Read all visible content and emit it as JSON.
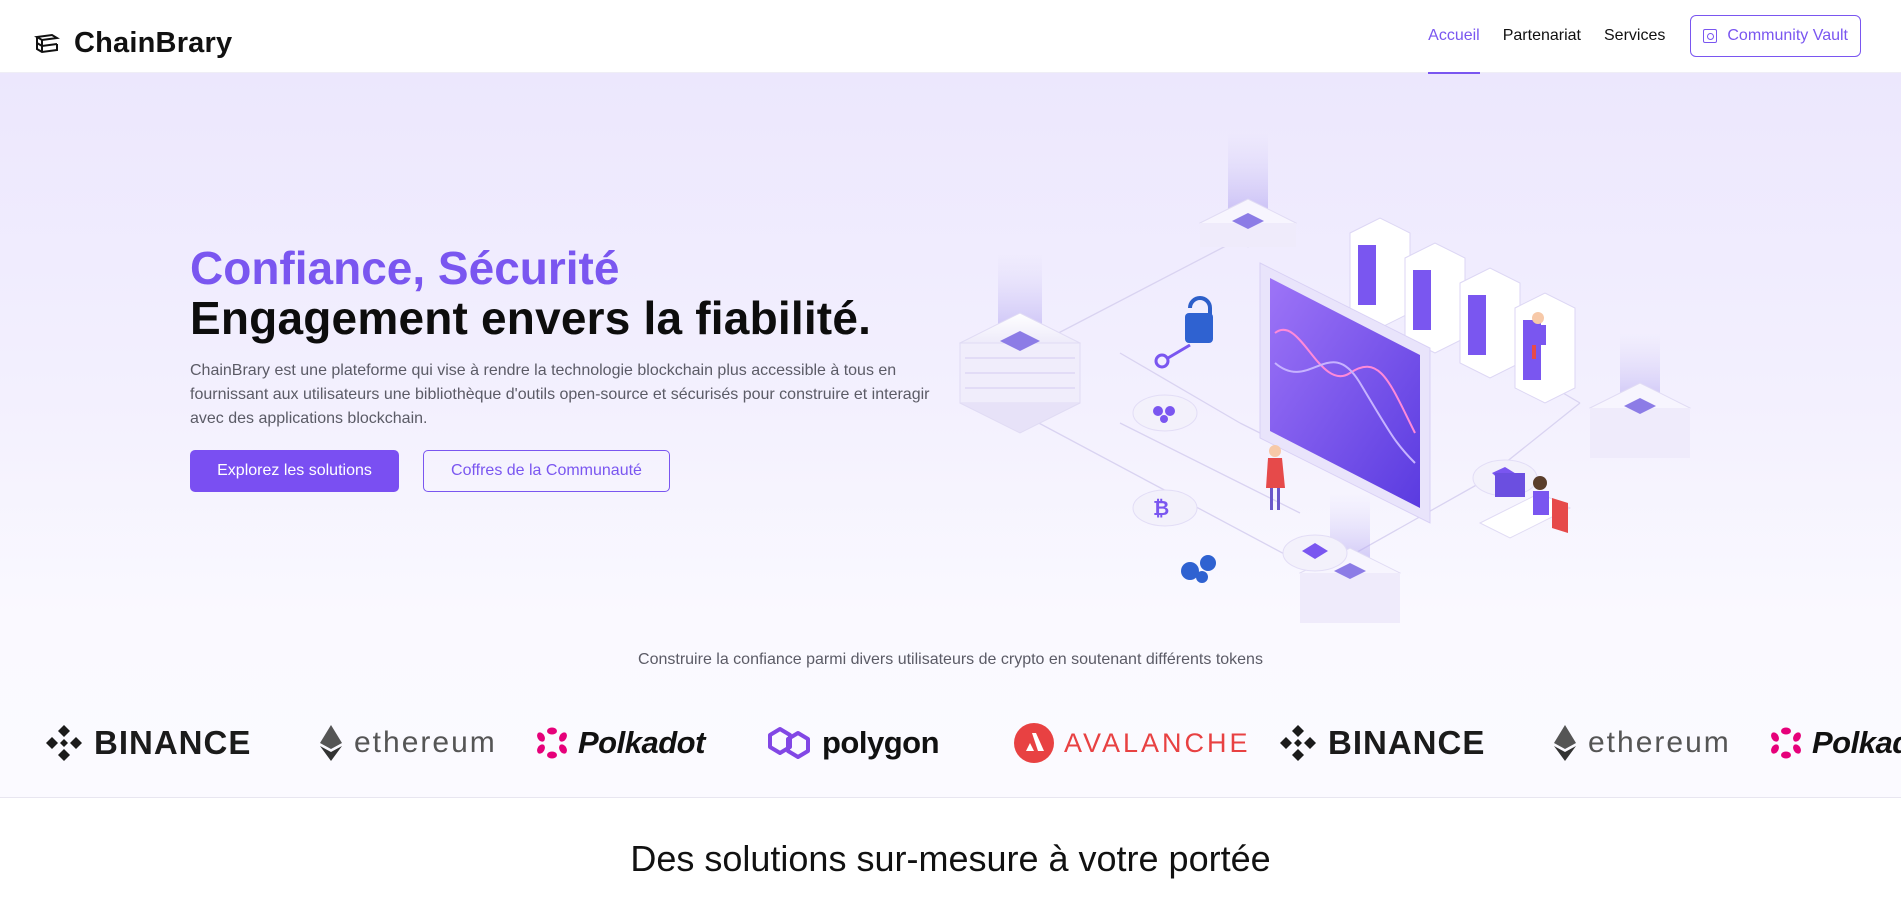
{
  "brand": {
    "name": "ChainBrary"
  },
  "nav": {
    "links": [
      "Accueil",
      "Partenariat",
      "Services"
    ],
    "active": "Accueil",
    "cta": "Community Vault"
  },
  "hero": {
    "accent_title": "Confiance, Sécurité",
    "main_title": "Engagement envers la fiabilité.",
    "description": "ChainBrary est une plateforme qui vise à rendre la technologie blockchain plus accessible à tous en fournissant aux utilisateurs une bibliothèque d'outils open-source et sécurisés pour construire et interagir avec des applications blockchain.",
    "primary_button": "Explorez les solutions",
    "secondary_button": "Coffres de la Communauté"
  },
  "tokens": {
    "tagline": "Construire la confiance parmi divers utilisateurs de crypto en soutenant différents tokens",
    "logos": [
      "BINANCE",
      "ethereum",
      "Polkadot",
      "polygon",
      "AVALANCHE",
      "BINANCE",
      "ethereum",
      "Polkadot"
    ]
  },
  "solutions": {
    "title": "Des solutions sur-mesure à votre portée"
  },
  "colors": {
    "accent": "#7a56f0",
    "primary_button": "#7a4ff2",
    "avalanche": "#e84142",
    "polkadot": "#e6007a",
    "polygon": "#8247e5"
  }
}
